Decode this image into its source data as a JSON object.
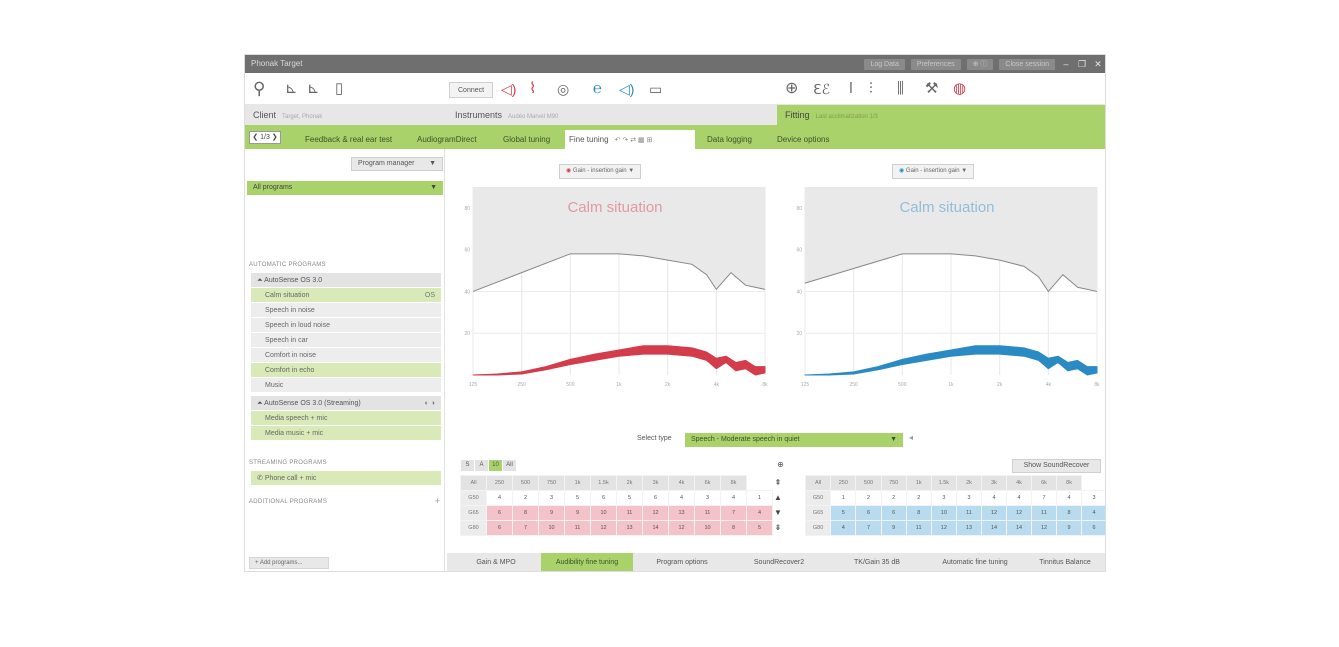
{
  "window": {
    "title": "Phonak Target",
    "title_right": [
      "Log Data",
      "Preferences",
      "⊕ ⓘ",
      "Close session"
    ]
  },
  "toolbar": {
    "connect_label": "Connect",
    "left_icons": [
      "client-user-icon",
      "audiogram-icon",
      "audiogram-alt-icon",
      "document-icon"
    ],
    "center_icons": [
      "ear-sound-left-icon",
      "earpiece-icon",
      "settings-knob-icon",
      "ear-right-icon",
      "speaker-icon",
      "battery-icon"
    ],
    "right_icons": [
      "target-icon",
      "ears-icon",
      "pen-icon",
      "sliders-icon",
      "bars-icon",
      "tools-icon",
      "sound-ears-icon"
    ]
  },
  "sections": {
    "client": {
      "label": "Client",
      "sub": "Target, Phonak"
    },
    "instruments": {
      "label": "Instruments",
      "sub": "Audéo Marvel M90"
    },
    "fitting": {
      "label": "Fitting",
      "sub": "Last acclimatization 1/3"
    }
  },
  "nav": {
    "label": "❮ 1/3 ❯"
  },
  "tabs": [
    {
      "label": "Feedback & real ear test",
      "active": false
    },
    {
      "label": "AudiogramDirect",
      "active": false
    },
    {
      "label": "Global tuning",
      "active": false
    },
    {
      "label": "Fine tuning",
      "active": true
    },
    {
      "label": "Data logging",
      "active": false
    },
    {
      "label": "Device options",
      "active": false
    }
  ],
  "programs": {
    "manager_label": "Program manager",
    "all_label": "All programs",
    "auto_header": "AUTOMATIC PROGRAMS",
    "autosense_label": "AutoSense OS 3.0",
    "auto_items": [
      {
        "label": "Calm situation",
        "tag": "OS",
        "style": "green"
      },
      {
        "label": "Speech in noise",
        "tag": "",
        "style": "grey"
      },
      {
        "label": "Speech in loud noise",
        "tag": "",
        "style": "grey"
      },
      {
        "label": "Speech in car",
        "tag": "",
        "style": "grey"
      },
      {
        "label": "Comfort in noise",
        "tag": "",
        "style": "grey"
      },
      {
        "label": "Comfort in echo",
        "tag": "",
        "style": "green"
      },
      {
        "label": "Music",
        "tag": "",
        "style": "grey"
      }
    ],
    "streaming_group_label": "AutoSense OS 3.0 (Streaming)",
    "streaming_group_tag": "◐ ◑",
    "streaming_items": [
      {
        "label": "Media speech + mic"
      },
      {
        "label": "Media music + mic"
      }
    ],
    "streaming_header": "STREAMING PROGRAMS",
    "phone_label": "Phone call + mic",
    "additional_header": "ADDITIONAL PROGRAMS",
    "add_label": "+ Add programs...",
    "add_plus": "+"
  },
  "gain_selectors": {
    "left": "Gain - insertion gain",
    "right": "Gain - insertion gain"
  },
  "select_type": {
    "label": "Select type",
    "value": "Speech - Moderate speech in quiet",
    "extra": "◂"
  },
  "level_buttons": [
    {
      "label": "S",
      "active": false
    },
    {
      "label": "A",
      "active": false
    },
    {
      "label": "10",
      "active": true
    },
    {
      "label": "All",
      "active": false
    }
  ],
  "link_icon": "⊕",
  "show_soundrecover": "Show SoundRecover",
  "freq_headers": [
    "All",
    "250",
    "500",
    "750",
    "1k",
    "1.5k",
    "2k",
    "3k",
    "4k",
    "6k",
    "8k"
  ],
  "left_table": [
    {
      "label": "G50",
      "cells": [
        "4",
        "2",
        "3",
        "5",
        "6",
        "5",
        "6",
        "4",
        "3",
        "4",
        "1"
      ],
      "style": "none"
    },
    {
      "label": "G65",
      "cells": [
        "6",
        "8",
        "9",
        "9",
        "10",
        "11",
        "12",
        "13",
        "11",
        "7",
        "4"
      ],
      "style": "pink"
    },
    {
      "label": "G80",
      "cells": [
        "6",
        "7",
        "10",
        "11",
        "12",
        "13",
        "14",
        "12",
        "10",
        "8",
        "5"
      ],
      "style": "pink"
    }
  ],
  "right_table": [
    {
      "label": "G50",
      "cells": [
        "1",
        "2",
        "2",
        "2",
        "3",
        "3",
        "4",
        "4",
        "7",
        "4",
        "3"
      ],
      "style": "none"
    },
    {
      "label": "G65",
      "cells": [
        "5",
        "6",
        "6",
        "8",
        "10",
        "11",
        "12",
        "12",
        "11",
        "8",
        "4"
      ],
      "style": "blue"
    },
    {
      "label": "G80",
      "cells": [
        "4",
        "7",
        "9",
        "11",
        "12",
        "13",
        "14",
        "14",
        "12",
        "9",
        "6"
      ],
      "style": "blue"
    }
  ],
  "arrows": [
    "⇞",
    "▲",
    "▼",
    "⇟"
  ],
  "bottom_tabs": [
    {
      "label": "Gain & MPO",
      "active": false
    },
    {
      "label": "Audibility fine tuning",
      "active": true
    },
    {
      "label": "Program options",
      "active": false
    },
    {
      "label": "SoundRecover2",
      "active": false
    },
    {
      "label": "TK/Gain 35 dB",
      "active": false
    },
    {
      "label": "Automatic fine tuning",
      "active": false
    },
    {
      "label": "Tinnitus Balance",
      "active": false
    }
  ],
  "chart_data": [
    {
      "type": "area",
      "title": "Calm situation",
      "color": "#d43b4b",
      "xlabel": "",
      "ylabel": "",
      "x_ticks": [
        "125",
        "250",
        "500",
        "1k",
        "2k",
        "4k",
        "8k"
      ],
      "y_ticks": [
        "80",
        "60",
        "40",
        "20"
      ],
      "grid": true,
      "series": [
        {
          "name": "",
          "x": [
            0,
            1,
            2,
            3,
            3.5,
            4,
            4.5,
            4.8,
            5,
            5.3,
            5.6,
            6
          ],
          "y": [
            40,
            49,
            58,
            58,
            57,
            55,
            53,
            48,
            41,
            49,
            43,
            41
          ]
        },
        {
          "name": "",
          "x": [
            0,
            0.5,
            1,
            1.5,
            2,
            2.5,
            3,
            3.5,
            4,
            4.5,
            4.8,
            5,
            5.2,
            5.4,
            5.6,
            5.8,
            6
          ],
          "y_low": [
            0,
            0,
            0.5,
            2.5,
            5,
            7,
            9,
            10,
            10,
            9,
            7,
            3,
            6,
            2,
            3,
            0,
            1
          ],
          "y_high": [
            0,
            0.5,
            1.5,
            4,
            7.5,
            10,
            12,
            14,
            14,
            13,
            11,
            8,
            9,
            6,
            7,
            4,
            4
          ]
        }
      ]
    },
    {
      "type": "area",
      "title": "Calm situation",
      "color": "#2a8ac4",
      "xlabel": "",
      "ylabel": "",
      "x_ticks": [
        "125",
        "250",
        "500",
        "1k",
        "2k",
        "4k",
        "8k"
      ],
      "y_ticks": [
        "80",
        "60",
        "40",
        "20"
      ],
      "grid": true,
      "series": [
        {
          "name": "",
          "x": [
            0,
            1,
            2,
            3,
            3.5,
            4,
            4.5,
            4.8,
            5,
            5.3,
            5.6,
            6
          ],
          "y": [
            44,
            51,
            58,
            58,
            57,
            55,
            52,
            47,
            40,
            48,
            42,
            40
          ]
        },
        {
          "name": "",
          "x": [
            0,
            0.5,
            1,
            1.5,
            2,
            2.5,
            3,
            3.5,
            4,
            4.5,
            4.8,
            5,
            5.2,
            5.4,
            5.6,
            5.8,
            6
          ],
          "y_low": [
            0,
            0,
            0.5,
            2.5,
            5,
            7,
            9,
            10,
            10,
            9,
            7,
            3,
            6,
            2,
            3,
            0,
            1
          ],
          "y_high": [
            0,
            0.5,
            1.5,
            4,
            7.5,
            10,
            12,
            14,
            14,
            13,
            11,
            8,
            9,
            6,
            7,
            4,
            4
          ]
        }
      ]
    }
  ]
}
